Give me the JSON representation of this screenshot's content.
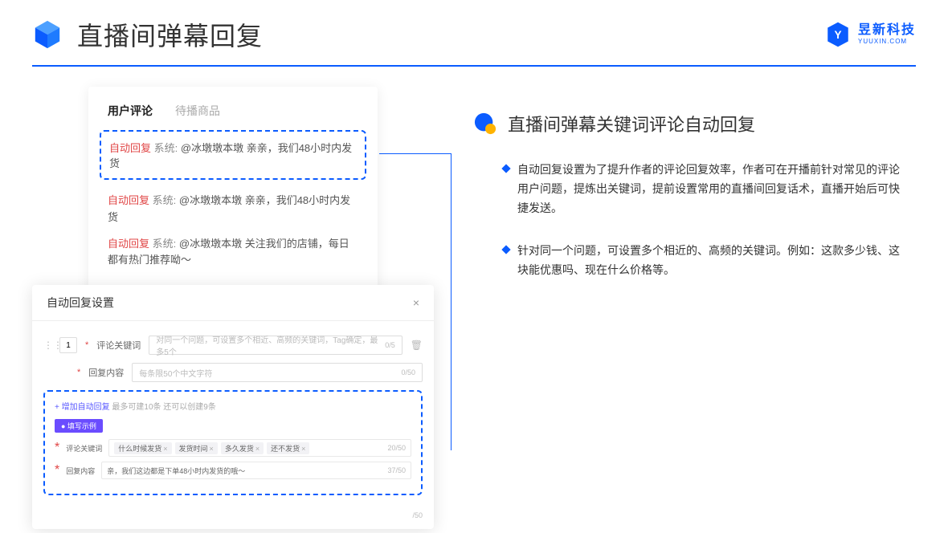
{
  "header": {
    "title": "直播间弹幕回复",
    "brand_name": "昱新科技",
    "brand_sub": "YUUXIN.COM"
  },
  "comment": {
    "tab_active": "用户评论",
    "tab_inactive": "待播商品",
    "rows": [
      {
        "tag": "自动回复",
        "sys": "系统:",
        "text": "@冰墩墩本墩 亲亲，我们48小时内发货"
      },
      {
        "tag": "自动回复",
        "sys": "系统:",
        "text": "@冰墩墩本墩 亲亲，我们48小时内发货"
      },
      {
        "tag": "自动回复",
        "sys": "系统:",
        "text": "@冰墩墩本墩 关注我们的店铺，每日都有热门推荐呦～"
      }
    ]
  },
  "settings": {
    "title": "自动回复设置",
    "num": "1",
    "label_keyword": "评论关键词",
    "placeholder_keyword": "对同一个问题，可设置多个相近、高频的关键词，Tag确定，最多5个",
    "counter_keyword": "0/5",
    "label_reply": "回复内容",
    "placeholder_reply": "每条限50个中文字符",
    "counter_reply": "0/50",
    "add_link": "+ 增加自动回复",
    "add_hint": "最多可建10条 还可以创建9条",
    "badge": "● 填写示例",
    "ex_label_keyword": "评论关键词",
    "ex_tags": [
      "什么时候发货",
      "发货时间",
      "多久发货",
      "还不发货"
    ],
    "ex_counter_keyword": "20/50",
    "ex_label_reply": "回复内容",
    "ex_reply_value": "亲，我们这边都是下单48小时内发货的哦～",
    "ex_counter_reply": "37/50",
    "bottom_counter": "/50"
  },
  "right": {
    "section_title": "直播间弹幕关键词评论自动回复",
    "bullets": [
      "自动回复设置为了提升作者的评论回复效率，作者可在开播前针对常见的评论用户问题，提炼出关键词，提前设置常用的直播间回复话术，直播开始后可快捷发送。",
      "针对同一个问题，可设置多个相近的、高频的关键词。例如：这款多少钱、这块能优惠吗、现在什么价格等。"
    ]
  }
}
